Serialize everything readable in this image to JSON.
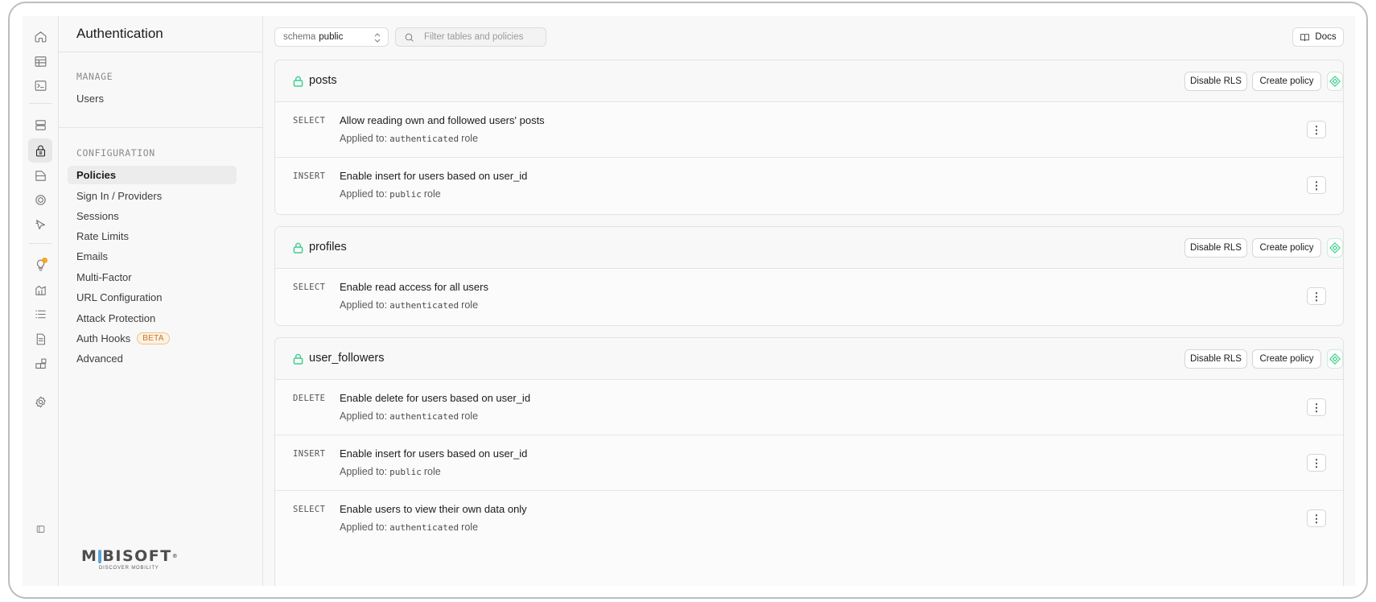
{
  "sidebar": {
    "title": "Authentication",
    "manage_label": "MANAGE",
    "manage_items": [
      {
        "label": "Users"
      }
    ],
    "config_label": "CONFIGURATION",
    "config_items": [
      {
        "label": "Policies",
        "active": true
      },
      {
        "label": "Sign In / Providers"
      },
      {
        "label": "Sessions"
      },
      {
        "label": "Rate Limits"
      },
      {
        "label": "Emails"
      },
      {
        "label": "Multi-Factor"
      },
      {
        "label": "URL Configuration"
      },
      {
        "label": "Attack Protection"
      },
      {
        "label": "Auth Hooks",
        "badge": "BETA"
      },
      {
        "label": "Advanced"
      }
    ]
  },
  "rail": {
    "icons": [
      "home-icon",
      "table-editor-icon",
      "sql-editor-icon",
      "database-icon",
      "authentication-icon",
      "storage-icon",
      "realtime-icon",
      "edge-functions-icon",
      "advisors-icon",
      "reports-icon",
      "logs-icon",
      "api-docs-icon",
      "integrations-icon",
      "settings-icon",
      "sidebar-toggle-icon"
    ]
  },
  "logo": {
    "text": "MOBISOFT",
    "tagline": "DISCOVER MOBILITY",
    "reg": "®"
  },
  "toolbar": {
    "schema_label": "schema",
    "schema_value": "public",
    "filter_placeholder": "Filter tables and policies",
    "docs_label": "Docs"
  },
  "buttons": {
    "disable_rls": "Disable RLS",
    "create_policy": "Create policy"
  },
  "applied_prefix": "Applied to:",
  "role_suffix": "role",
  "tables": [
    {
      "name": "posts",
      "policies": [
        {
          "command": "SELECT",
          "name": "Allow reading own and followed users' posts",
          "role": "authenticated"
        },
        {
          "command": "INSERT",
          "name": "Enable insert for users based on user_id",
          "role": "public"
        }
      ]
    },
    {
      "name": "profiles",
      "policies": [
        {
          "command": "SELECT",
          "name": "Enable read access for all users",
          "role": "authenticated"
        }
      ]
    },
    {
      "name": "user_followers",
      "policies": [
        {
          "command": "DELETE",
          "name": "Enable delete for users based on user_id",
          "role": "authenticated"
        },
        {
          "command": "INSERT",
          "name": "Enable insert for users based on user_id",
          "role": "public"
        },
        {
          "command": "SELECT",
          "name": "Enable users to view their own data only",
          "role": "authenticated"
        }
      ]
    }
  ],
  "colors": {
    "accent": "#3ecf8e",
    "beta": "#c3772c",
    "advisor_dot": "#f5a623"
  }
}
